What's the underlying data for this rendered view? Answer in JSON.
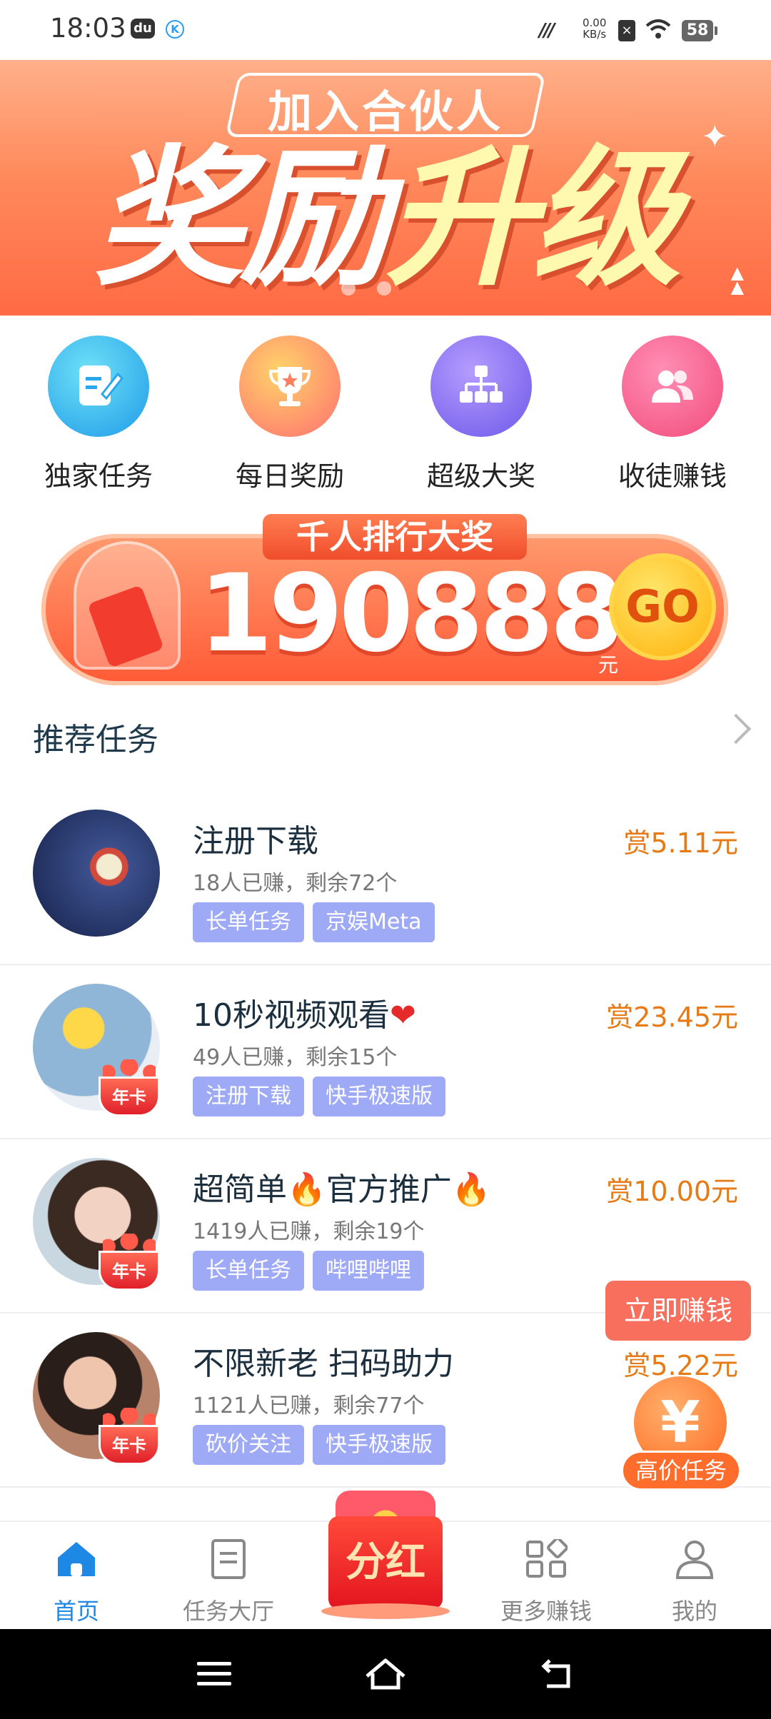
{
  "status_bar": {
    "time": "18:03",
    "app1": "du",
    "app2": "K",
    "signal": "///",
    "speed_value": "0.00",
    "speed_unit": "KB/s",
    "battery": "58"
  },
  "banner": {
    "subtitle": "加入合伙人",
    "title_white": "奖励",
    "title_yellow": "升级",
    "dots": 2,
    "active_dot": 1
  },
  "menu": {
    "items": [
      {
        "label": "独家任务",
        "icon": "edit-icon"
      },
      {
        "label": "每日奖励",
        "icon": "trophy-icon"
      },
      {
        "label": "超级大奖",
        "icon": "hierarchy-icon"
      },
      {
        "label": "收徒赚钱",
        "icon": "users-icon"
      }
    ]
  },
  "rank_banner": {
    "tag": "千人排行大奖",
    "amount": "190888",
    "unit": "元",
    "go": "GO"
  },
  "section": {
    "title": "推荐任务"
  },
  "tasks": [
    {
      "title": "注册下载",
      "emoji": "",
      "reward": "赏5.11元",
      "meta": "18人已赚，剩余72个",
      "tags": [
        "长单任务",
        "京娱Meta"
      ],
      "badge": ""
    },
    {
      "title": "10秒视频观看",
      "emoji": "❤",
      "reward": "赏23.45元",
      "meta": "49人已赚，剩余15个",
      "tags": [
        "注册下载",
        "快手极速版"
      ],
      "badge": "年卡"
    },
    {
      "title": "超简单🔥官方推广🔥",
      "emoji": "",
      "reward": "赏10.00元",
      "meta": "1419人已赚，剩余19个",
      "tags": [
        "长单任务",
        "哔哩哔哩"
      ],
      "badge": "年卡"
    },
    {
      "title": "不限新老 扫码助力",
      "emoji": "",
      "reward": "赏5.22元",
      "meta": "1121人已赚，剩余77个",
      "tags": [
        "砍价关注",
        "快手极速版"
      ],
      "badge": "年卡"
    }
  ],
  "floating": {
    "earn_now": "立即赚钱",
    "coin": "¥",
    "high_price": "高价任务"
  },
  "bottom_nav": {
    "items": [
      {
        "label": "首页",
        "icon": "home-icon",
        "active": true
      },
      {
        "label": "任务大厅",
        "icon": "document-icon",
        "active": false
      },
      {
        "label": "更多赚钱",
        "icon": "apps-icon",
        "active": false
      },
      {
        "label": "我的",
        "icon": "person-icon",
        "active": false
      }
    ],
    "center_label": "分红"
  },
  "colors": {
    "accent": "#1e88e5",
    "reward": "#e57a16",
    "tag": "#9eaaf6",
    "banner": "#ff6a44"
  }
}
